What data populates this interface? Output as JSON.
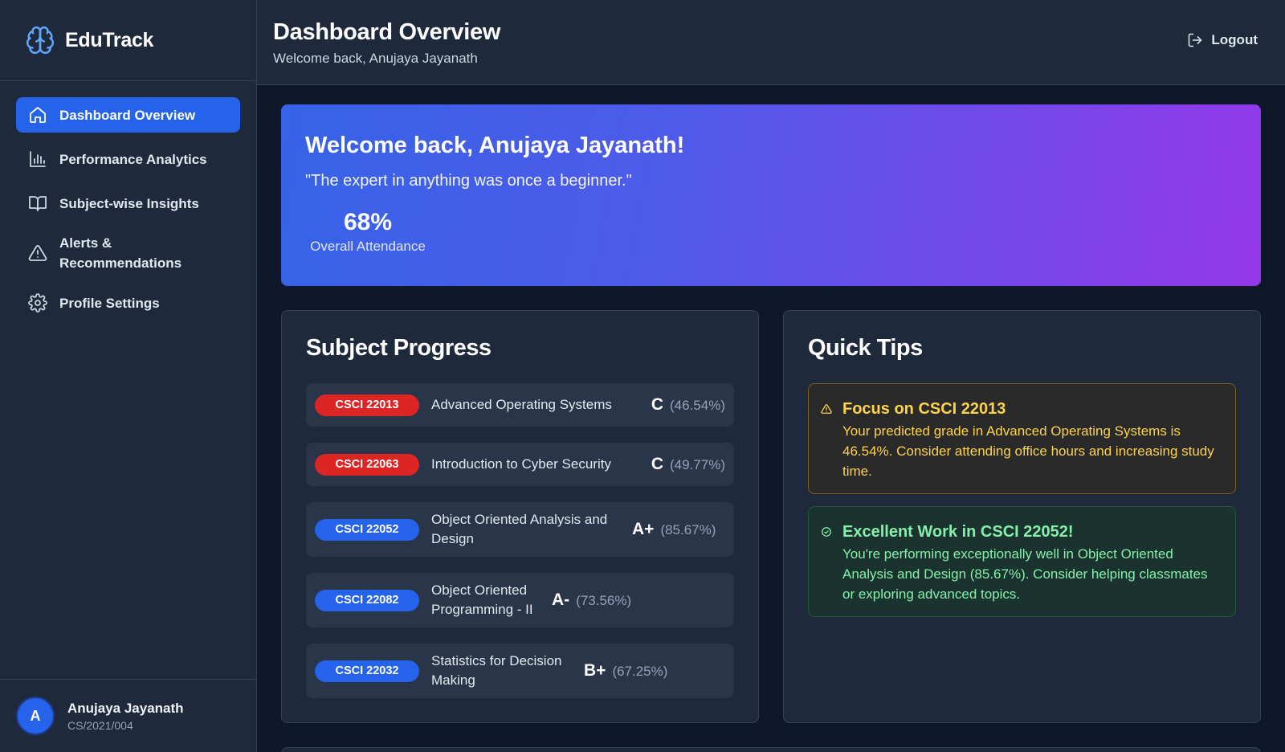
{
  "app": {
    "name": "EduTrack"
  },
  "sidebar": {
    "items": [
      {
        "label": "Dashboard Overview",
        "icon": "home-icon",
        "active": true
      },
      {
        "label": "Performance Analytics",
        "icon": "bar-chart-icon"
      },
      {
        "label": "Subject-wise Insights",
        "icon": "book-icon"
      },
      {
        "label": "Alerts & Recommendations",
        "icon": "alert-triangle-icon"
      },
      {
        "label": "Profile Settings",
        "icon": "gear-icon"
      }
    ],
    "user": {
      "initial": "A",
      "name": "Anujaya Jayanath",
      "id": "CS/2021/004"
    }
  },
  "header": {
    "title": "Dashboard Overview",
    "subtitle": "Welcome back, Anujaya Jayanath",
    "logout_label": "Logout"
  },
  "banner": {
    "title": "Welcome back, Anujaya Jayanath!",
    "quote": "\"The expert in anything was once a beginner.\"",
    "attendance_value": "68%",
    "attendance_label": "Overall Attendance",
    "gradient": [
      "#3663e8",
      "#9437e8"
    ]
  },
  "subject_progress": {
    "title": "Subject Progress",
    "subjects": [
      {
        "code": "CSCI 22013",
        "name": "Advanced Operating Systems",
        "grade": "C",
        "percent": "(46.54%)",
        "status": "danger"
      },
      {
        "code": "CSCI 22063",
        "name": "Introduction to Cyber Security",
        "grade": "C",
        "percent": "(49.77%)",
        "status": "danger"
      },
      {
        "code": "CSCI 22052",
        "name": "Object Oriented Analysis and Design",
        "grade": "A+",
        "percent": "(85.67%)",
        "status": "ok"
      },
      {
        "code": "CSCI 22082",
        "name": "Object Oriented Programming - II",
        "grade": "A-",
        "percent": "(73.56%)",
        "status": "ok"
      },
      {
        "code": "CSCI 22032",
        "name": "Statistics for Decision Making",
        "grade": "B+",
        "percent": "(67.25%)",
        "status": "ok"
      }
    ]
  },
  "quick_tips": {
    "title": "Quick Tips",
    "tips": [
      {
        "type": "warning",
        "title": "Focus on CSCI 22013",
        "text": "Your predicted grade in Advanced Operating Systems is 46.54%. Consider attending office hours and increasing study time."
      },
      {
        "type": "success",
        "title": "Excellent Work in CSCI 22052!",
        "text": "You're performing exceptionally well in Object Oriented Analysis and Design (85.67%). Consider helping classmates or exploring advanced topics."
      }
    ]
  },
  "colors": {
    "accent": "#2563eb",
    "danger_badge": "#dc2626",
    "ok_badge": "#2563eb",
    "warning_text": "#fcd34d",
    "success_text": "#86efac"
  }
}
